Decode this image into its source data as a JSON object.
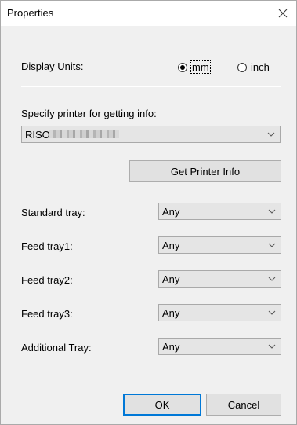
{
  "window": {
    "title": "Properties"
  },
  "display_units": {
    "label": "Display Units:",
    "options": [
      {
        "label": "mm",
        "selected": true
      },
      {
        "label": "inch",
        "selected": false
      }
    ]
  },
  "printer": {
    "label": "Specify printer for getting info:",
    "selected_value": "RISO",
    "get_info_button": "Get Printer Info"
  },
  "trays": [
    {
      "label": "Standard tray:",
      "value": "Any"
    },
    {
      "label": "Feed tray1:",
      "value": "Any"
    },
    {
      "label": "Feed tray2:",
      "value": "Any"
    },
    {
      "label": "Feed tray3:",
      "value": "Any"
    },
    {
      "label": "Additional Tray:",
      "value": "Any"
    }
  ],
  "footer": {
    "ok_label": "OK",
    "cancel_label": "Cancel"
  },
  "colors": {
    "dialog_bg": "#f0f0f0",
    "titlebar_bg": "#ffffff",
    "default_button_border": "#0078d7"
  }
}
